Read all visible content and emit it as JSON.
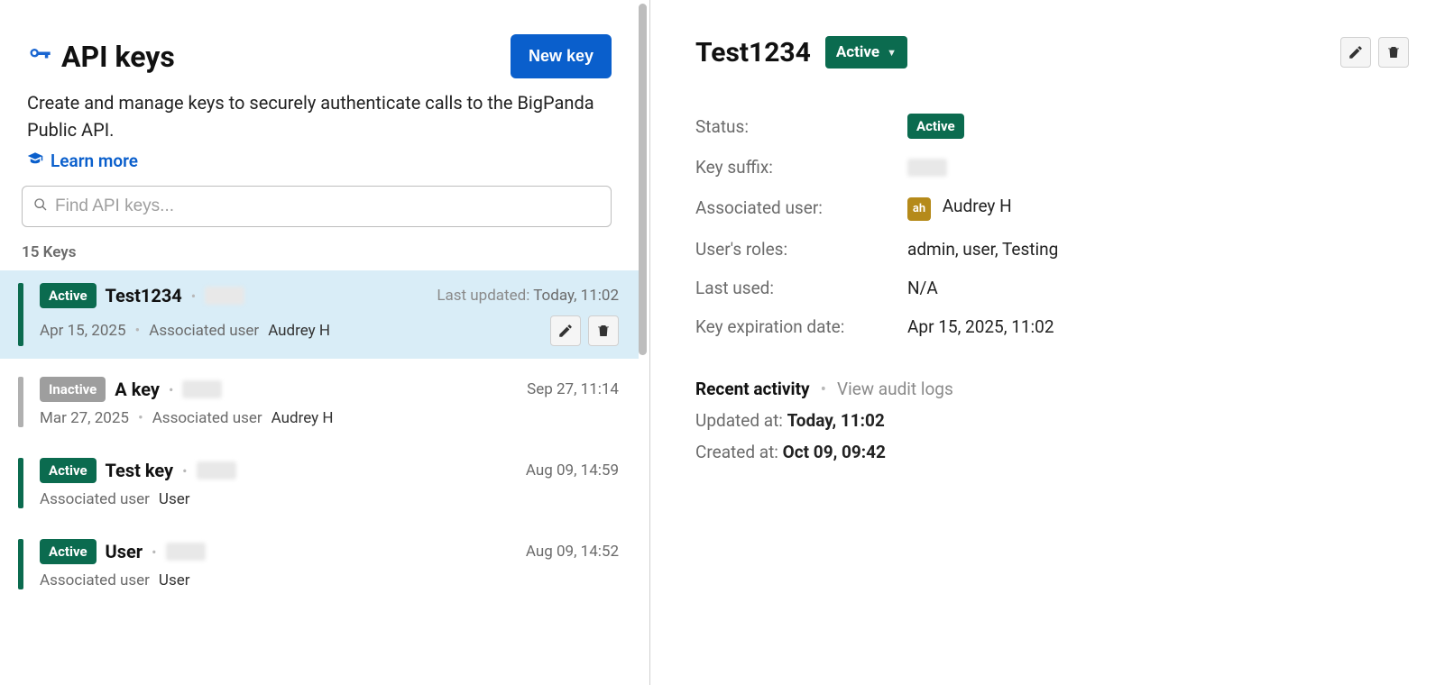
{
  "header": {
    "title": "API keys",
    "new_key_button": "New key",
    "description": "Create and manage keys to securely authenticate calls to the BigPanda Public API.",
    "learn_more": "Learn more"
  },
  "search": {
    "placeholder": "Find API keys..."
  },
  "list": {
    "count_label": "15 Keys",
    "last_updated_label": "Last updated:",
    "associated_user_label": "Associated user",
    "items": [
      {
        "status": "Active",
        "name": "Test1234",
        "suffix_hidden": true,
        "last_updated": "Today, 11:02",
        "show_last_updated_label": true,
        "date": "Apr 15, 2025",
        "associated_user": "Audrey H",
        "selected": true,
        "show_actions": true
      },
      {
        "status": "Inactive",
        "name": "A key",
        "suffix_hidden": true,
        "last_updated": "Sep 27, 11:14",
        "show_last_updated_label": false,
        "date": "Mar 27, 2025",
        "associated_user": "Audrey H",
        "selected": false,
        "show_actions": false
      },
      {
        "status": "Active",
        "name": "Test key",
        "suffix_hidden": true,
        "last_updated": "Aug 09, 14:59",
        "show_last_updated_label": false,
        "date": "",
        "associated_user": "User",
        "selected": false,
        "show_actions": false
      },
      {
        "status": "Active",
        "name": "User",
        "suffix_hidden": true,
        "last_updated": "Aug 09, 14:52",
        "show_last_updated_label": false,
        "date": "",
        "associated_user": "User",
        "selected": false,
        "show_actions": false
      }
    ]
  },
  "detail": {
    "title": "Test1234",
    "status_dropdown": "Active",
    "fields": {
      "status_label": "Status:",
      "status_value": "Active",
      "suffix_label": "Key suffix:",
      "suffix_hidden": true,
      "user_label": "Associated user:",
      "user_avatar": "ah",
      "user_name": "Audrey H",
      "roles_label": "User's roles:",
      "roles_value": "admin, user, Testing",
      "last_used_label": "Last used:",
      "last_used_value": "N/A",
      "expires_label": "Key expiration date:",
      "expires_value": "Apr 15, 2025, 11:02"
    },
    "activity": {
      "heading": "Recent activity",
      "view_logs": "View audit logs",
      "updated_label": "Updated at:",
      "updated_value": "Today, 11:02",
      "created_label": "Created at:",
      "created_value": "Oct 09, 09:42"
    }
  }
}
